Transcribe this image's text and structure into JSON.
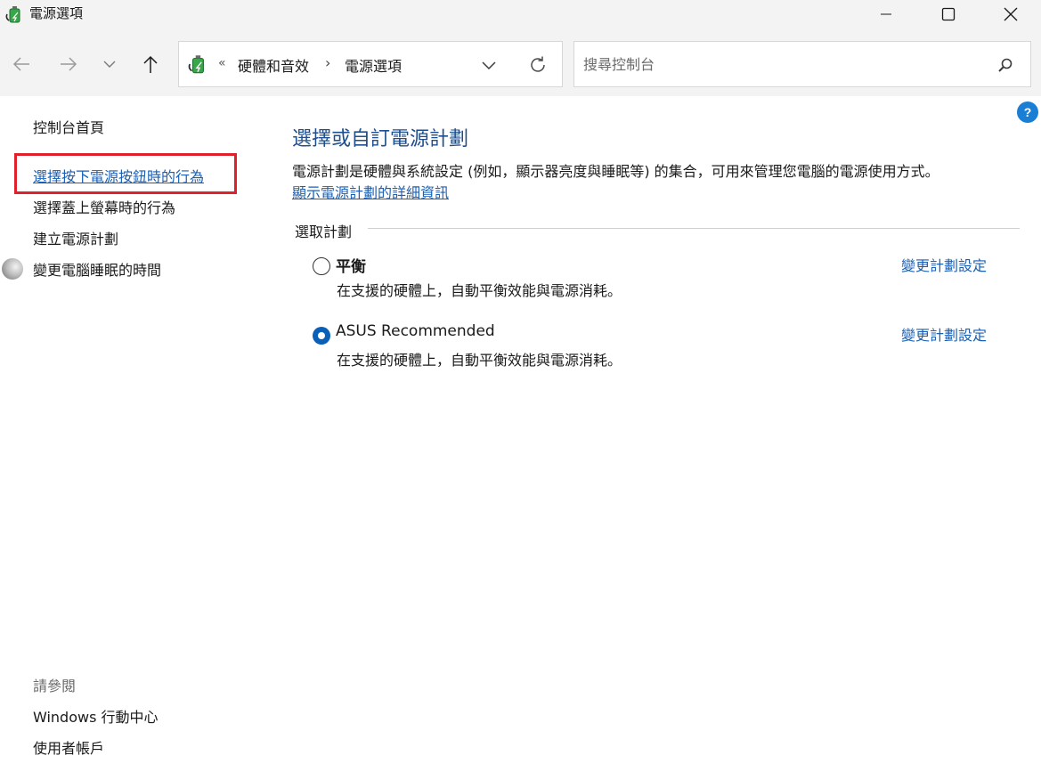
{
  "window": {
    "title": "電源選項",
    "minimize_icon": "minimize-icon",
    "maximize_icon": "maximize-icon",
    "close_icon": "close-icon"
  },
  "address_bar": {
    "overflow_marker": "«",
    "breadcrumbs": [
      {
        "label": "硬體和音效"
      },
      {
        "label": "電源選項"
      }
    ],
    "separator": "›"
  },
  "search": {
    "placeholder": "搜尋控制台",
    "value": ""
  },
  "left_pane": {
    "home": "控制台首頁",
    "links": [
      {
        "label": "選擇按下電源按鈕時的行為"
      },
      {
        "label": "選擇蓋上螢幕時的行為"
      },
      {
        "label": "建立電源計劃"
      },
      {
        "label": "變更電腦睡眠的時間"
      }
    ],
    "see_also_heading": "請參閱",
    "see_also": [
      {
        "label": "Windows 行動中心"
      },
      {
        "label": "使用者帳戶"
      }
    ]
  },
  "main": {
    "title": "選擇或自訂電源計劃",
    "description": "電源計劃是硬體與系統設定 (例如，顯示器亮度與睡眠等) 的集合，可用來管理您電腦的電源使用方式。",
    "details_link": "顯示電源計劃的詳細資訊",
    "group_label": "選取計劃",
    "plans": [
      {
        "name": "平衡",
        "description": "在支援的硬體上，自動平衡效能與電源消耗。",
        "change_link": "變更計劃設定",
        "selected": false
      },
      {
        "name": "ASUS Recommended",
        "description": "在支援的硬體上，自動平衡效能與電源消耗。",
        "change_link": "變更計劃設定",
        "selected": true
      }
    ]
  },
  "help": {
    "label": "?"
  },
  "colors": {
    "link": "#1a5fb4",
    "title": "#1e4e8c",
    "highlight": "#e0202a",
    "radio_checked": "#0a5fb8"
  }
}
